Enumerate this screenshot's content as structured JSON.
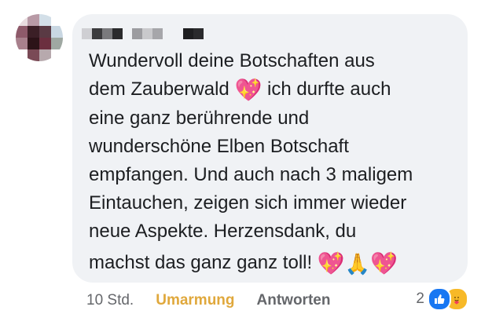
{
  "comment": {
    "lines": [
      "Wundervoll deine Botschaften aus",
      "dem Zauberwald",
      " ich durfte auch",
      "eine ganz berührende und",
      "wunderschöne Elben Botschaft",
      "empfangen. Und auch nach 3 maligem",
      "Eintauchen, zeigen sich immer wieder",
      "neue Aspekte. Herzensdank, du",
      "machst das ganz ganz toll!"
    ],
    "emoji": {
      "sparkling_heart": "💖",
      "folded_hands": "🙏"
    }
  },
  "footer": {
    "timestamp": "10 Std.",
    "react_label": "Umarmung",
    "reply_label": "Antworten",
    "reaction_count": "2"
  },
  "colors": {
    "bubble": "#f0f2f5",
    "text": "#1c1e21",
    "muted": "#65676b",
    "care_reaction": "#e0a83c",
    "like_blue": "#1877f2"
  },
  "icons": [
    "like-icon",
    "care-icon"
  ]
}
